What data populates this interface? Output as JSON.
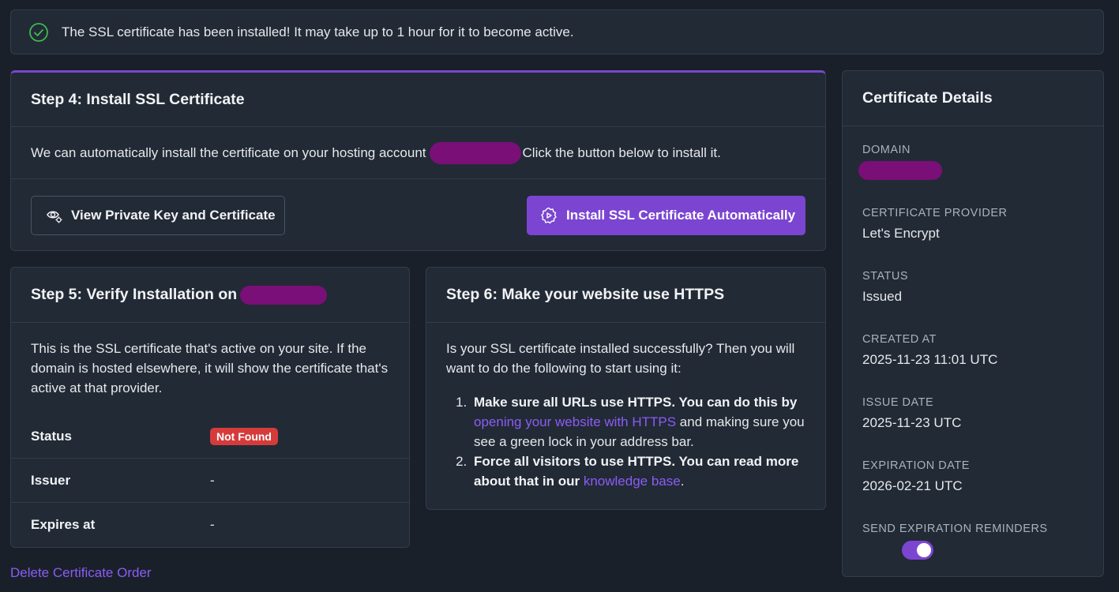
{
  "alert": {
    "message": "The SSL certificate has been installed! It may take up to 1 hour for it to become active.",
    "icon": "check-circle-icon",
    "color": "#3fb950"
  },
  "step4": {
    "title": "Step 4: Install SSL Certificate",
    "desc_before": "We can automatically install the certificate on your hosting account",
    "desc_after": "Click the button below to install it.",
    "view_button": "View Private Key and Certificate",
    "install_button": "Install SSL Certificate Automatically"
  },
  "step5": {
    "title": "Step 5: Verify Installation on",
    "body": "This is the SSL certificate that's active on your site. If the domain is hosted elsewhere, it will show the certificate that's active at that provider.",
    "rows": [
      {
        "label": "Status",
        "value": "Not Found"
      },
      {
        "label": "Issuer",
        "value": "-"
      },
      {
        "label": "Expires at",
        "value": "-"
      }
    ]
  },
  "step6": {
    "title": "Step 6: Make your website use HTTPS",
    "intro": "Is your SSL certificate installed successfully? Then you will want to do the following to start using it:",
    "item1_bold": "Make sure all URLs use HTTPS. You can do this by",
    "item1_link": "opening your website with HTTPS",
    "item1_rest": "and making sure you see a green lock in your address bar.",
    "item2_bold": "Force all visitors to use HTTPS. You can read more about that in our",
    "item2_link": "knowledge base",
    "item2_rest": "."
  },
  "delete_link": "Delete Certificate Order",
  "details": {
    "title": "Certificate Details",
    "domain_label": "DOMAIN",
    "provider_label": "CERTIFICATE PROVIDER",
    "provider": "Let's Encrypt",
    "status_label": "STATUS",
    "status": "Issued",
    "created_label": "CREATED AT",
    "created": "2025-11-23 11:01 UTC",
    "issue_label": "ISSUE DATE",
    "issue": "2025-11-23 UTC",
    "expiration_label": "EXPIRATION DATE",
    "expiration": "2026-02-21 UTC",
    "reminders_label": "SEND EXPIRATION REMINDERS",
    "reminders_on": true
  },
  "colors": {
    "accent": "#7b45d1",
    "link": "#8b5cf6",
    "danger": "#d63b3b",
    "redaction": "#7a0f78"
  }
}
